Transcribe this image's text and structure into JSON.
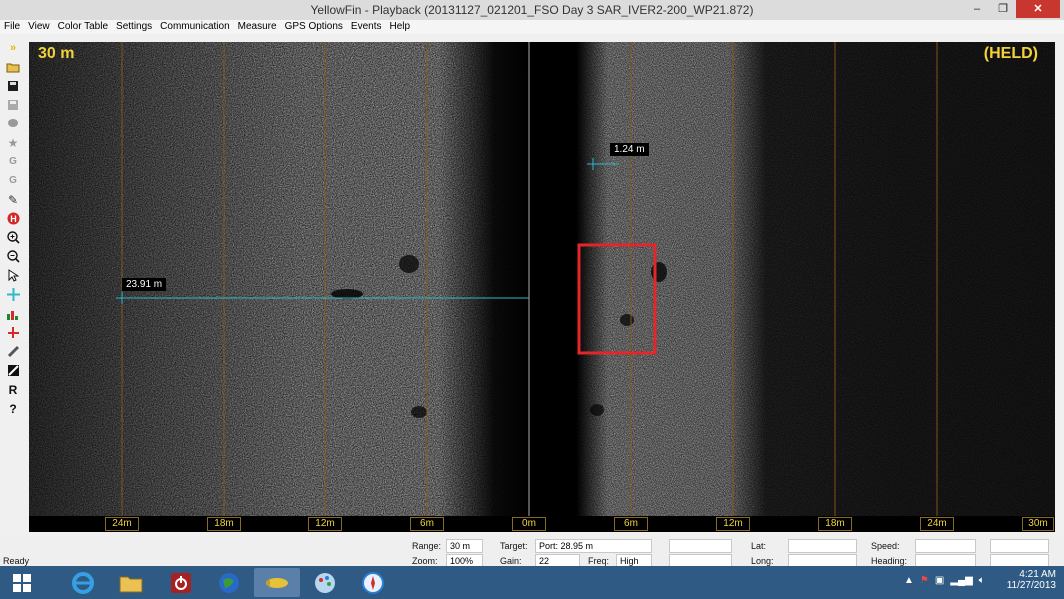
{
  "window": {
    "title": "YellowFin - Playback (20131127_021201_FSO Day 3 SAR_IVER2-200_WP21.872)",
    "controls": [
      "–",
      "❐",
      "✕"
    ]
  },
  "menubar": [
    "File",
    "View",
    "Color Table",
    "Settings",
    "Communication",
    "Measure",
    "GPS Options",
    "Events",
    "Help"
  ],
  "toolbar_icons": [
    "chevrons-icon",
    "folder-open-icon",
    "save-icon",
    "save-disabled-icon",
    "waypoint-icon",
    "star-icon",
    "grid-g-icon",
    "grid-g2-icon",
    "pencil-icon",
    "h-marker-icon",
    "zoom-in-icon",
    "zoom-out-icon",
    "pointer-icon",
    "crosshair-icon",
    "bar-chart-icon",
    "t-marker-icon",
    "ruler-icon",
    "color-table-icon",
    "r-icon",
    "help-icon"
  ],
  "sonar": {
    "range_label": "30 m",
    "held_label": "(HELD)",
    "measure_left": "23.91 m",
    "measure_right": "1.24 m",
    "scale_labels": [
      "24m",
      "18m",
      "12m",
      "6m",
      "0m",
      "6m",
      "12m",
      "18m",
      "24m",
      "30m"
    ]
  },
  "status": {
    "ready": "Ready",
    "range_label": "Range:",
    "range_value": "30 m",
    "zoom_label": "Zoom:",
    "zoom_value": "100%",
    "target_label": "Target:",
    "target_value": "Port: 28.95 m",
    "gain_label": "Gain:",
    "gain_value": "22",
    "freq_label": "Freq:",
    "freq_value": "High",
    "lat_label": "Lat:",
    "long_label": "Long:",
    "speed_label": "Speed:",
    "heading_label": "Heading:"
  },
  "taskbar": {
    "time": "4:21 AM",
    "date": "11/27/2013",
    "apps": [
      "start-icon",
      "ie-icon",
      "explorer-icon",
      "power-app-icon",
      "globe-app-icon",
      "yellowfin-app-icon",
      "paint-app-icon",
      "compass-app-icon"
    ]
  },
  "colors": {
    "accent": "#f2d23c",
    "measure_line": "#2fb9c9",
    "highlight_box": "#e2262a",
    "taskbar": "#2f5a83"
  }
}
